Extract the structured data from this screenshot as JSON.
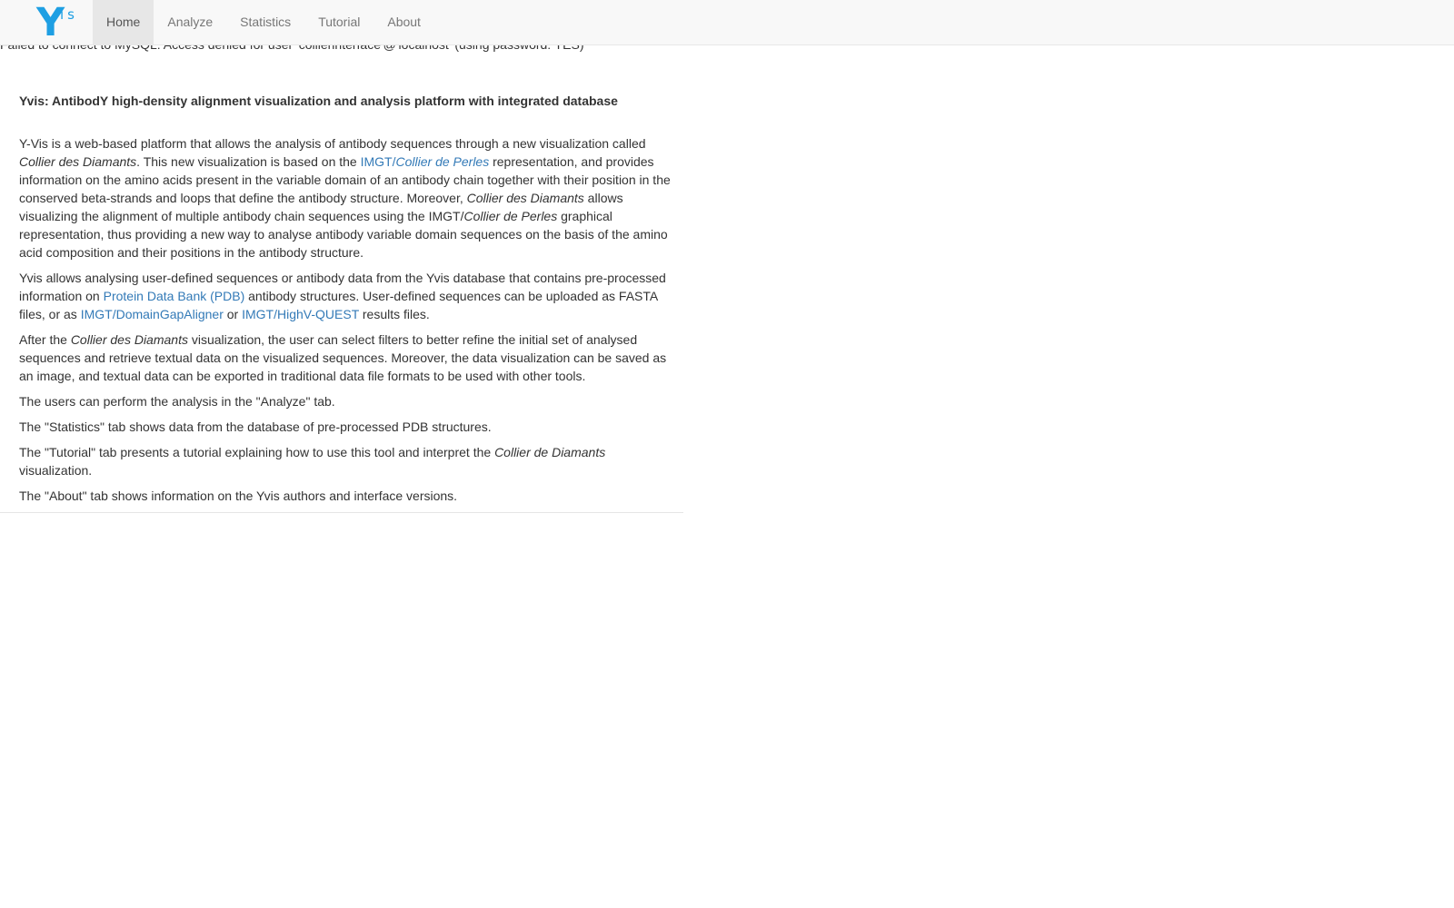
{
  "error_message": "Failed to connect to MySQL: Access denied for user 'collierinterface'@'localhost' (using password: YES)",
  "brand": {
    "y": "Y",
    "is": "is"
  },
  "nav": {
    "items": [
      {
        "label": "Home",
        "active": true
      },
      {
        "label": "Analyze"
      },
      {
        "label": "Statistics"
      },
      {
        "label": "Tutorial"
      },
      {
        "label": "About"
      }
    ]
  },
  "main": {
    "title": "Yvis: AntibodY high-density alignment visualization and analysis platform with integrated database",
    "p1": {
      "t1": "Y-Vis is a web-based platform that allows the analysis of antibody sequences through a new visualization called ",
      "em1": "Collier des Diamants",
      "t2": ". This new visualization is based on the ",
      "link_prefix": "IMGT/",
      "link_em": "Collier de Perles",
      "t3": " representation, and provides information on the amino acids present in the variable domain of an antibody chain together with their position in the conserved beta-strands and loops that define the antibody structure. Moreover, ",
      "em2": "Collier des Diamants",
      "t4": " allows visualizing the alignment of multiple antibody chain sequences using the IMGT/",
      "em3": "Collier de Perles",
      "t5": " graphical representation, thus providing a new way to analyse antibody variable domain sequences on the basis of the amino acid composition and their positions in the antibody structure."
    },
    "p2": {
      "t1": "Yvis allows analysing user-defined sequences or antibody data from the Yvis database that contains pre-processed information on ",
      "link1": "Protein Data Bank (PDB)",
      "t2": " antibody structures. User-defined sequences can be uploaded as FASTA files, or as ",
      "link2": "IMGT/DomainGapAligner",
      "t3": " or ",
      "link3": "IMGT/HighV-QUEST",
      "t4": " results files."
    },
    "p3": {
      "t1": "After the ",
      "em1": "Collier des Diamants",
      "t2": " visualization, the user can select filters to better refine the initial set of analysed sequences and retrieve textual data on the visualized sequences. Moreover, the data visualization can be saved as an image, and textual data can be exported in traditional data file formats to be used with other tools."
    },
    "p4": "The users can perform the analysis in the \"Analyze\" tab.",
    "p5": "The \"Statistics\" tab shows data from the database of pre-processed PDB structures.",
    "p6": {
      "t1": "The \"Tutorial\" tab presents a tutorial explaining how to use this tool and interpret the ",
      "em1": "Collier de Diamants",
      "t2": " visualization."
    },
    "p7": "The \"About\" tab shows information on the Yvis authors and interface versions."
  }
}
